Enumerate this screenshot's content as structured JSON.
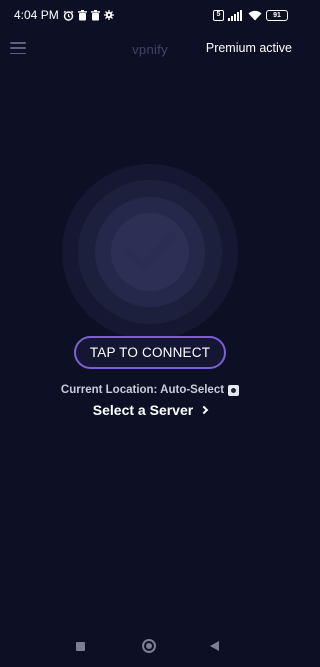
{
  "status_bar": {
    "time": "4:04 PM",
    "left_icons": [
      "alarm-icon",
      "trash-icon",
      "trash-icon",
      "gear-icon"
    ],
    "right_icons": [
      "vpn-key-icon",
      "signal-icon",
      "wifi-icon"
    ],
    "box_icon_text": "5",
    "battery": "91"
  },
  "app_bar": {
    "title": "vpnify",
    "premium_label": "Premium active"
  },
  "main": {
    "connect_label": "TAP TO CONNECT",
    "location_text": "Current Location: Auto-Select",
    "select_server_label": "Select a Server"
  },
  "colors": {
    "background": "#0d0f24",
    "button_border": "#7c5fd6",
    "title_color": "#3d4466"
  }
}
